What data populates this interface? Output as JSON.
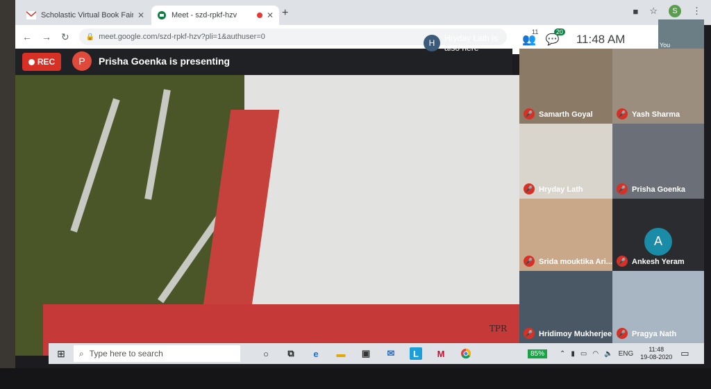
{
  "browser": {
    "tabs": [
      {
        "title": "Scholastic Virtual Book Fair - shr",
        "icon": "gmail-icon",
        "close": "✕"
      },
      {
        "title": "Meet - szd-rpkf-hzv",
        "icon": "meet-icon",
        "close": "✕"
      }
    ],
    "new_tab": "+",
    "profile_initial": "S",
    "url": "meet.google.com/szd-rpkf-hzv?pli=1&authuser=0"
  },
  "meet": {
    "rec_label": "REC",
    "presenter_initial": "P",
    "presenting_text": "Prisha Goenka is presenting",
    "also_here_initial": "H",
    "also_here_text": "Hryday Lath is also here",
    "participants_count": "11",
    "chat_count": "20",
    "time": "11:48 AM",
    "self_label": "You",
    "watermark": "TPR",
    "participants": [
      {
        "name": "Samarth Goyal",
        "muted": true,
        "bg": "#8a7a66"
      },
      {
        "name": "Yash Sharma",
        "muted": true,
        "bg": "#9b8e7f"
      },
      {
        "name": "Hryday Lath",
        "muted": true,
        "bg": "#d9d4cc"
      },
      {
        "name": "Prisha Goenka",
        "muted": true,
        "bg": "#6a6f78"
      },
      {
        "name": "Srida mouktika Ari...",
        "muted": true,
        "bg": "#c9a88a"
      },
      {
        "name": "Ankesh Yeram",
        "muted": true,
        "bg": "#2b2c30",
        "avatar": "A"
      },
      {
        "name": "Hridimoy Mukherjee",
        "muted": true,
        "bg": "#4a5866"
      },
      {
        "name": "Pragya Nath",
        "muted": true,
        "bg": "#a8b6c3"
      }
    ]
  },
  "taskbar": {
    "search_placeholder": "Type here to search",
    "battery": "85%",
    "language": "ENG",
    "time": "11:48",
    "date": "19-08-2020"
  }
}
